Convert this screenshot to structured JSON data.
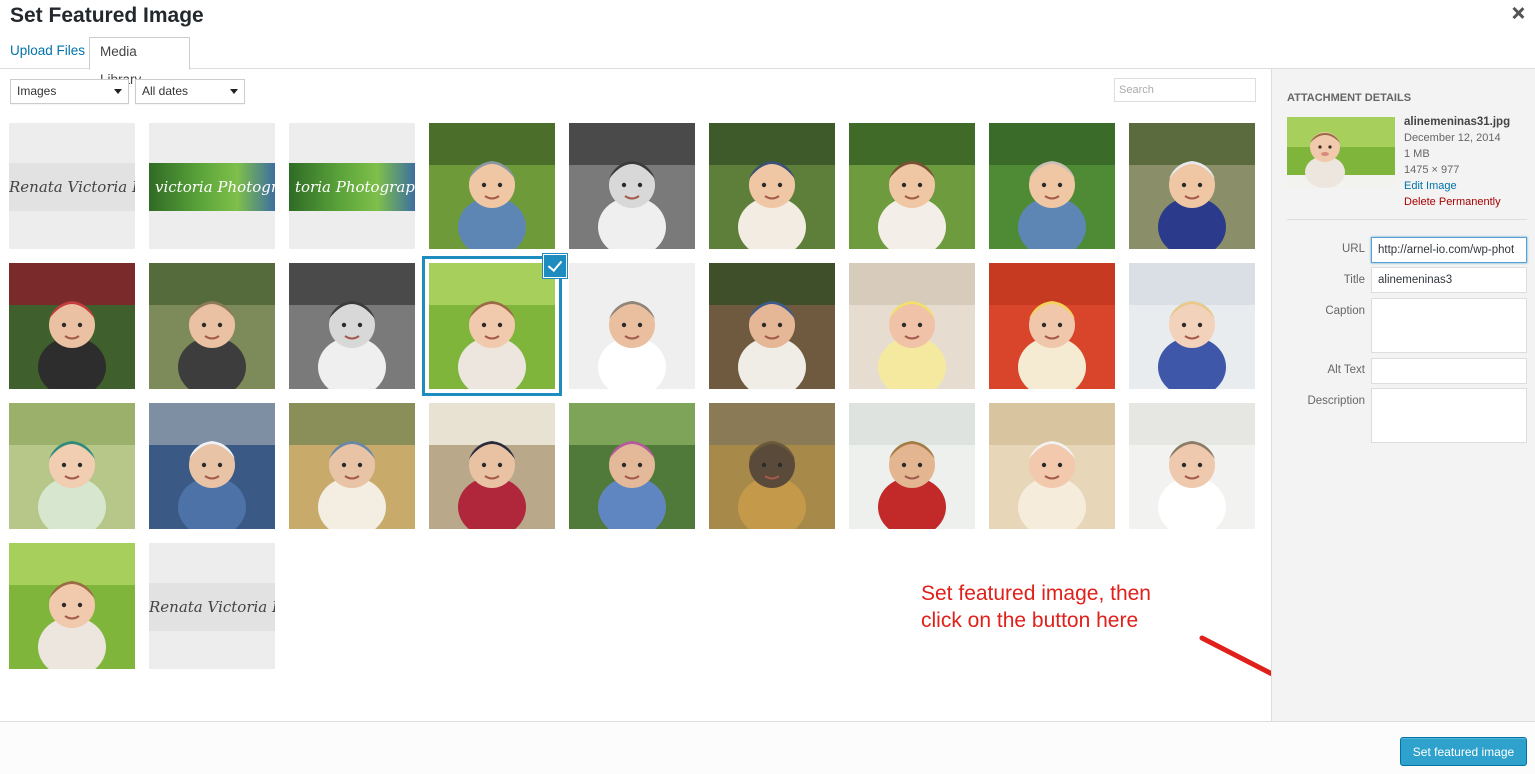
{
  "modal": {
    "title": "Set Featured Image"
  },
  "tabs": [
    {
      "label": "Upload Files",
      "active": false
    },
    {
      "label": "Media Library",
      "active": true
    }
  ],
  "filters": {
    "type_value": "Images",
    "date_value": "All dates"
  },
  "search": {
    "placeholder": "Search"
  },
  "sidebar": {
    "heading": "ATTACHMENT DETAILS",
    "filename": "alinemeninas31.jpg",
    "date": "December 12, 2014",
    "size": "1 MB",
    "dimensions": "1475 × 977",
    "edit_label": "Edit Image",
    "delete_label": "Delete Permanently",
    "fields": {
      "url_label": "URL",
      "url_value": "http://arnel-io.com/wp-phot",
      "title_label": "Title",
      "title_value": "alinemeninas3",
      "caption_label": "Caption",
      "caption_value": "",
      "alt_label": "Alt Text",
      "alt_value": "",
      "description_label": "Description",
      "description_value": ""
    }
  },
  "footer": {
    "button_label": "Set featured image"
  },
  "annotation": {
    "line1": "Set featured image, then",
    "line2": "click on the button here",
    "color": "#e0201a"
  },
  "colors": {
    "accent": "#1e8cbe",
    "primary_button": "#2ea2cc",
    "link": "#0073aa",
    "delete": "#a00000"
  },
  "thumbnails": [
    {
      "name": "renata-victoria-banner",
      "kind": "banner",
      "text": "Renata Victoria Ph",
      "selected": false
    },
    {
      "name": "victoria-photography-green-banner",
      "kind": "banner-green",
      "text": "victoria Photography",
      "selected": false
    },
    {
      "name": "victoria-photography-green-banner-2",
      "kind": "banner-green",
      "text": "toria Photography",
      "selected": false
    },
    {
      "name": "baby-headband-grass",
      "kind": "photo",
      "scene": "baby-grass",
      "selected": false
    },
    {
      "name": "baby-bw-stool",
      "kind": "photo",
      "scene": "bw",
      "selected": false
    },
    {
      "name": "family-legs-baby",
      "kind": "photo",
      "scene": "family-legs",
      "selected": false
    },
    {
      "name": "baby-wooden-table",
      "kind": "photo",
      "scene": "baby-table",
      "selected": false
    },
    {
      "name": "baby-crawling-wood",
      "kind": "photo",
      "scene": "baby-grass2",
      "selected": false
    },
    {
      "name": "girl-stairs-navy-dress",
      "kind": "photo",
      "scene": "girl-stairs",
      "selected": false
    },
    {
      "name": "family-holiday-lights",
      "kind": "photo",
      "scene": "family-lights",
      "selected": false
    },
    {
      "name": "family-standing-woods",
      "kind": "photo",
      "scene": "family-woods",
      "selected": false
    },
    {
      "name": "baby-bw-stool-2",
      "kind": "photo",
      "scene": "bw",
      "selected": false
    },
    {
      "name": "toddler-hands-face",
      "kind": "photo",
      "scene": "toddler",
      "selected": true
    },
    {
      "name": "newborn-knit-hat",
      "kind": "photo",
      "scene": "newborn-hat",
      "selected": false
    },
    {
      "name": "woman-stairs-boots",
      "kind": "photo",
      "scene": "stairs-woman",
      "selected": false
    },
    {
      "name": "newborn-yellow-bow",
      "kind": "photo",
      "scene": "newborn-cream",
      "selected": false
    },
    {
      "name": "newborn-red-blanket",
      "kind": "photo",
      "scene": "newborn-red",
      "selected": false
    },
    {
      "name": "girl-blue-eyes-stripes",
      "kind": "photo",
      "scene": "girl-stripes",
      "selected": false
    },
    {
      "name": "girl-teal-headband",
      "kind": "photo",
      "scene": "girl-teal",
      "selected": false
    },
    {
      "name": "maternity-bunting",
      "kind": "photo",
      "scene": "maternity-bunting",
      "selected": false
    },
    {
      "name": "couple-guitar-field",
      "kind": "photo",
      "scene": "field-couple",
      "selected": false
    },
    {
      "name": "maternity-belly-red",
      "kind": "photo",
      "scene": "belly",
      "selected": false
    },
    {
      "name": "maternity-striped-dress",
      "kind": "photo",
      "scene": "maternity-dress",
      "selected": false
    },
    {
      "name": "autumn-tree",
      "kind": "photo",
      "scene": "tree",
      "selected": false
    },
    {
      "name": "curly-hair-girl",
      "kind": "photo",
      "scene": "curly",
      "selected": false
    },
    {
      "name": "newborn-smiling-headband",
      "kind": "photo",
      "scene": "newborn-smile",
      "selected": false
    },
    {
      "name": "newborn-puppy-hat",
      "kind": "photo",
      "scene": "newborn-puppy",
      "selected": false
    },
    {
      "name": "toddler-hands-face-2",
      "kind": "photo",
      "scene": "toddler",
      "selected": false
    },
    {
      "name": "renata-victoria-banner-2",
      "kind": "banner",
      "text": "Renata Victoria Pl",
      "selected": false
    }
  ]
}
